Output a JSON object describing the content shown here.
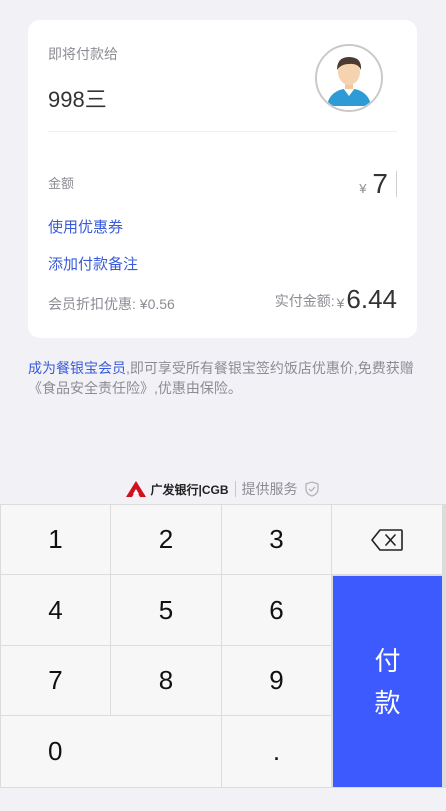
{
  "card": {
    "pay_to_label": "即将付款给",
    "payee_name": "998三",
    "amount_label": "金额",
    "currency": "¥",
    "amount_value": "7",
    "coupon_link": "使用优惠券",
    "note_link": "添加付款备注",
    "discount_text": "会员折扣优惠: ¥0.56",
    "actual_label": "实付金额:",
    "actual_currency": "¥",
    "actual_value": "6.44"
  },
  "promo": {
    "link_text": "成为餐银宝会员",
    "rest_text": ",即可享受所有餐银宝签约饭店优惠价,免费获赠《食品安全责任险》,优惠由保险。"
  },
  "provider": {
    "bank_name": "广发银行|CGB",
    "service_text": "提供服务",
    "bank_logo_icon": "cgb-logo-icon",
    "shield_icon": "shield-check-icon"
  },
  "keypad": {
    "keys": [
      "1",
      "2",
      "3",
      "4",
      "5",
      "6",
      "7",
      "8",
      "9",
      "0",
      "."
    ],
    "backspace_icon": "backspace-icon",
    "pay_label_line1": "付",
    "pay_label_line2": "款"
  },
  "colors": {
    "accent": "#3d5afe",
    "link": "#3a5bd9",
    "bank_red": "#d0101c"
  }
}
